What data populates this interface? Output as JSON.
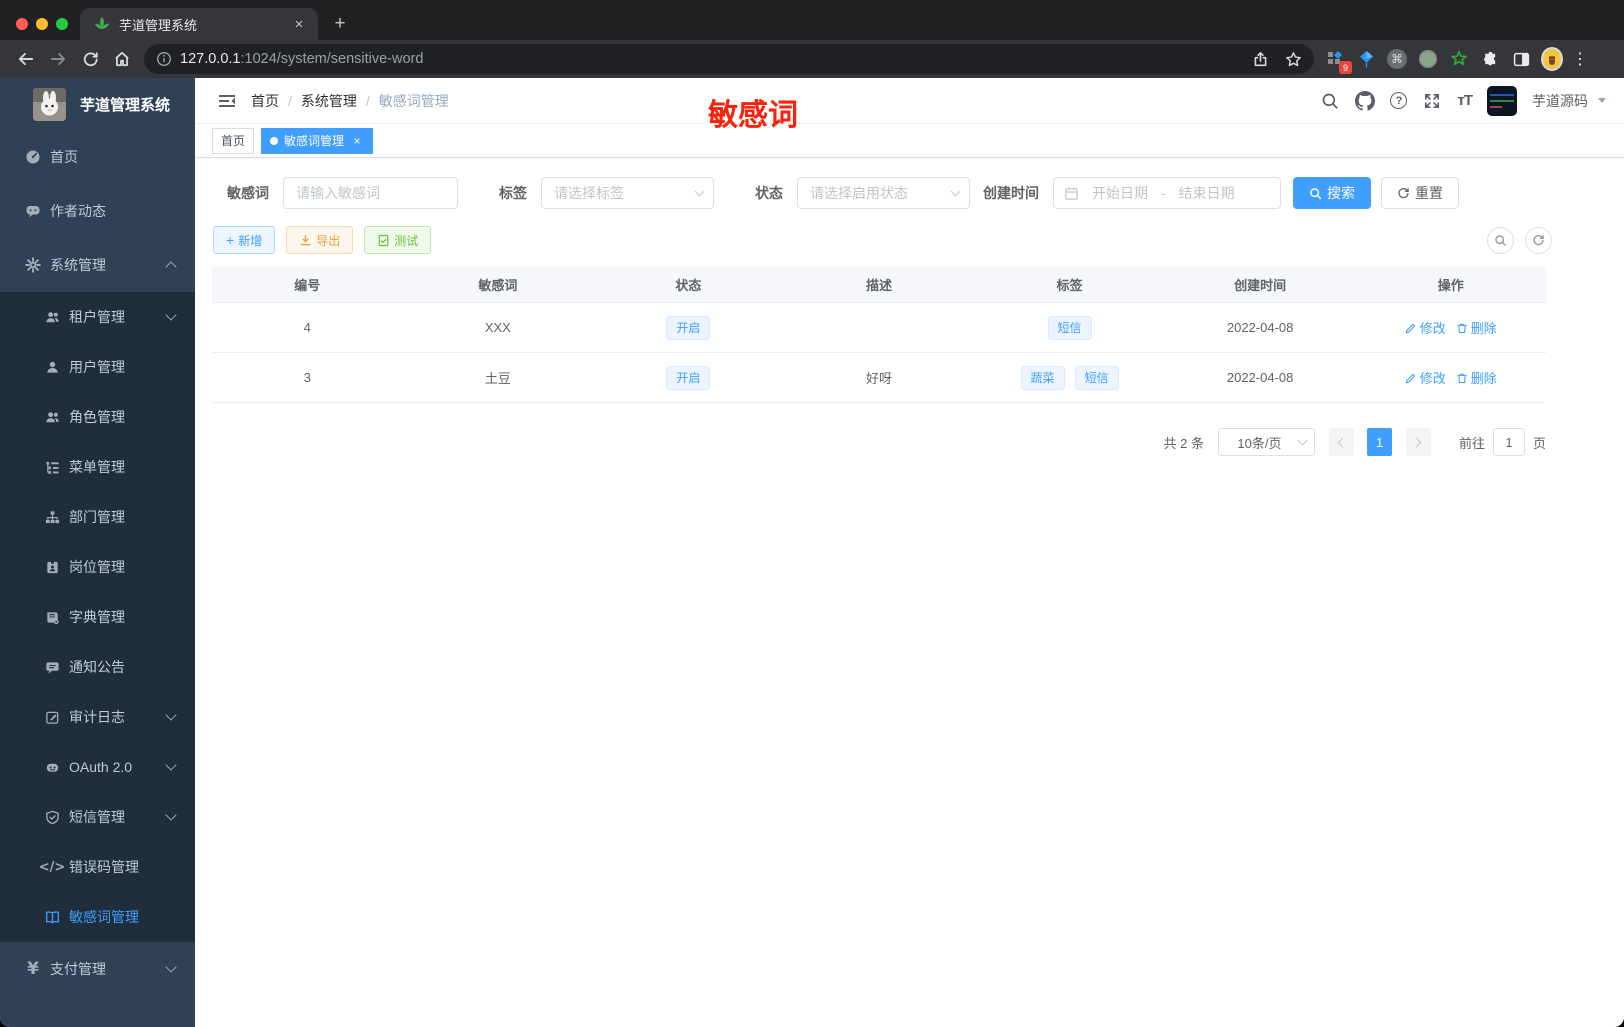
{
  "colors": {
    "primary": "#409eff",
    "sidebar_bg": "#304156",
    "submenu_bg": "#1f2d3d",
    "warning": "#e6a23c",
    "success": "#67c23a",
    "annotation_red": "#f9220d"
  },
  "chrome": {
    "tab_title": "芋道管理系统",
    "close_glyph": "×",
    "newtab_glyph": "+",
    "kebab_glyph": "⋮",
    "command_glyph": "⌘",
    "url_host": "127.0.0.1",
    "url_path": ":1024/system/sensitive-word",
    "extension_badge": "9"
  },
  "sidebar": {
    "logo_title": "芋道管理系统",
    "home": "首页",
    "author": "作者动态",
    "system": "系统管理",
    "payment": "支付管理",
    "code_glyph": "</>",
    "yen_glyph": "¥",
    "sub": [
      {
        "label": "租户管理"
      },
      {
        "label": "用户管理"
      },
      {
        "label": "角色管理"
      },
      {
        "label": "菜单管理"
      },
      {
        "label": "部门管理"
      },
      {
        "label": "岗位管理"
      },
      {
        "label": "字典管理"
      },
      {
        "label": "通知公告"
      },
      {
        "label": "审计日志"
      },
      {
        "label": "OAuth 2.0"
      },
      {
        "label": "短信管理"
      },
      {
        "label": "错误码管理"
      },
      {
        "label": "敏感词管理"
      }
    ]
  },
  "navbar": {
    "crumb_home": "首页",
    "crumb_sep": "/",
    "crumb_system": "系统管理",
    "crumb_current": "敏感词管理",
    "help_glyph": "?",
    "size_glyph": "тT",
    "username": "芋道源码"
  },
  "annotation": {
    "text": "敏感词"
  },
  "tags": {
    "home": "首页",
    "current": "敏感词管理",
    "close_glyph": "×"
  },
  "filters": {
    "word_label": "敏感词",
    "word_placeholder": "请输入敏感词",
    "tag_label": "标签",
    "tag_placeholder": "请选择标签",
    "status_label": "状态",
    "status_placeholder": "请选择启用状态",
    "date_label": "创建时间",
    "date_start": "开始日期",
    "date_sep": "-",
    "date_end": "结束日期",
    "search": "搜索",
    "reset": "重置"
  },
  "toolbar": {
    "add_glyph": "+",
    "add": "新增",
    "export": "导出",
    "test": "测试"
  },
  "table": {
    "headers": [
      "编号",
      "敏感词",
      "状态",
      "描述",
      "标签",
      "创建时间",
      "操作"
    ],
    "rows": [
      {
        "id": "4",
        "word": "XXX",
        "status": "开启",
        "desc": "",
        "created": "2022-04-08",
        "tags": [
          "短信"
        ]
      },
      {
        "id": "3",
        "word": "土豆",
        "status": "开启",
        "desc": "好呀",
        "created": "2022-04-08",
        "tags": [
          "蔬菜",
          "短信"
        ]
      }
    ],
    "edit": "修改",
    "delete": "删除"
  },
  "pagination": {
    "total": "共 2 条",
    "size": "10条/页",
    "page": "1",
    "goto": "前往",
    "goto_value": "1",
    "unit": "页"
  }
}
